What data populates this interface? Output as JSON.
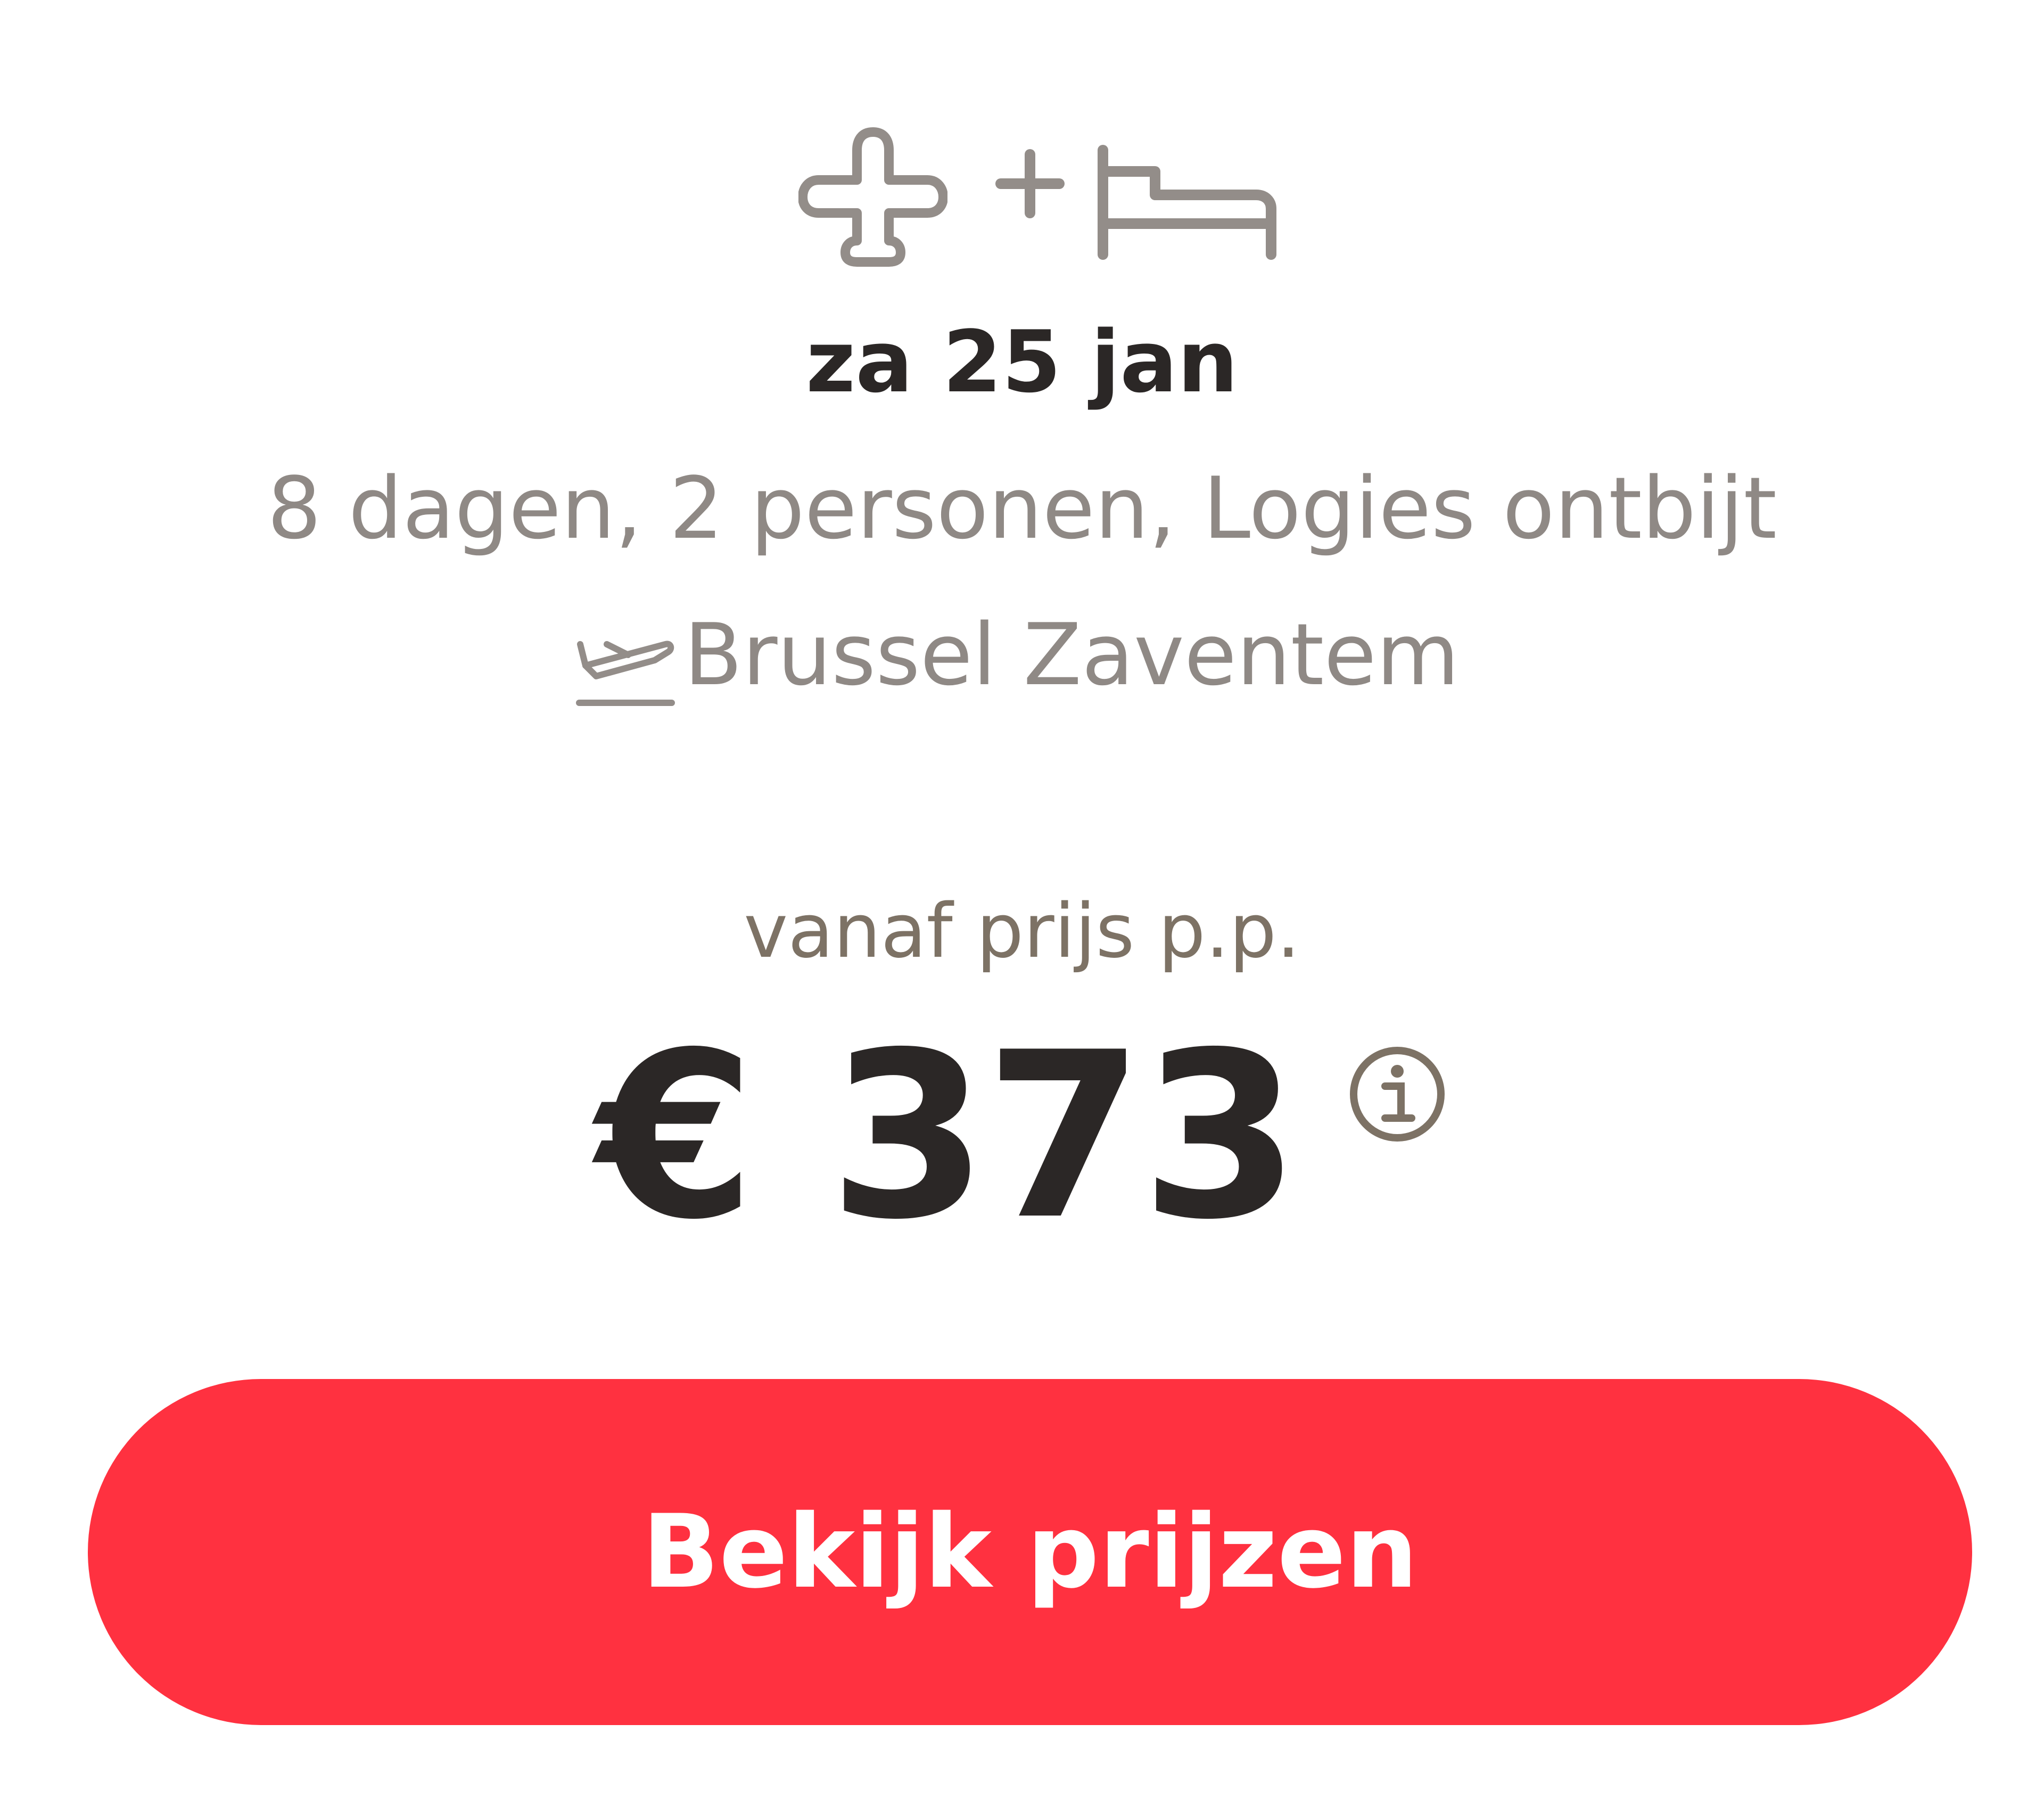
{
  "package": {
    "icons": {
      "flight": "airplane-icon",
      "plus": "plus-icon",
      "hotel": "bed-icon"
    },
    "plus_symbol": "+",
    "date": "za 25 jan",
    "details": "8 dagen, 2 personen, Logies ontbijt",
    "departure_icon": "departure-icon",
    "departure_airport": "Brussel Zaventem"
  },
  "pricing": {
    "from_label": "vanaf prijs p.p.",
    "price": "€ 373",
    "info_icon": "info-icon"
  },
  "cta": {
    "label": "Bekijk prijzen"
  },
  "colors": {
    "accent": "#ff3140",
    "text_dark": "#2b2726",
    "text_muted": "#8f8985",
    "text_brown": "#7d7265",
    "icon_gray": "#938d89"
  }
}
